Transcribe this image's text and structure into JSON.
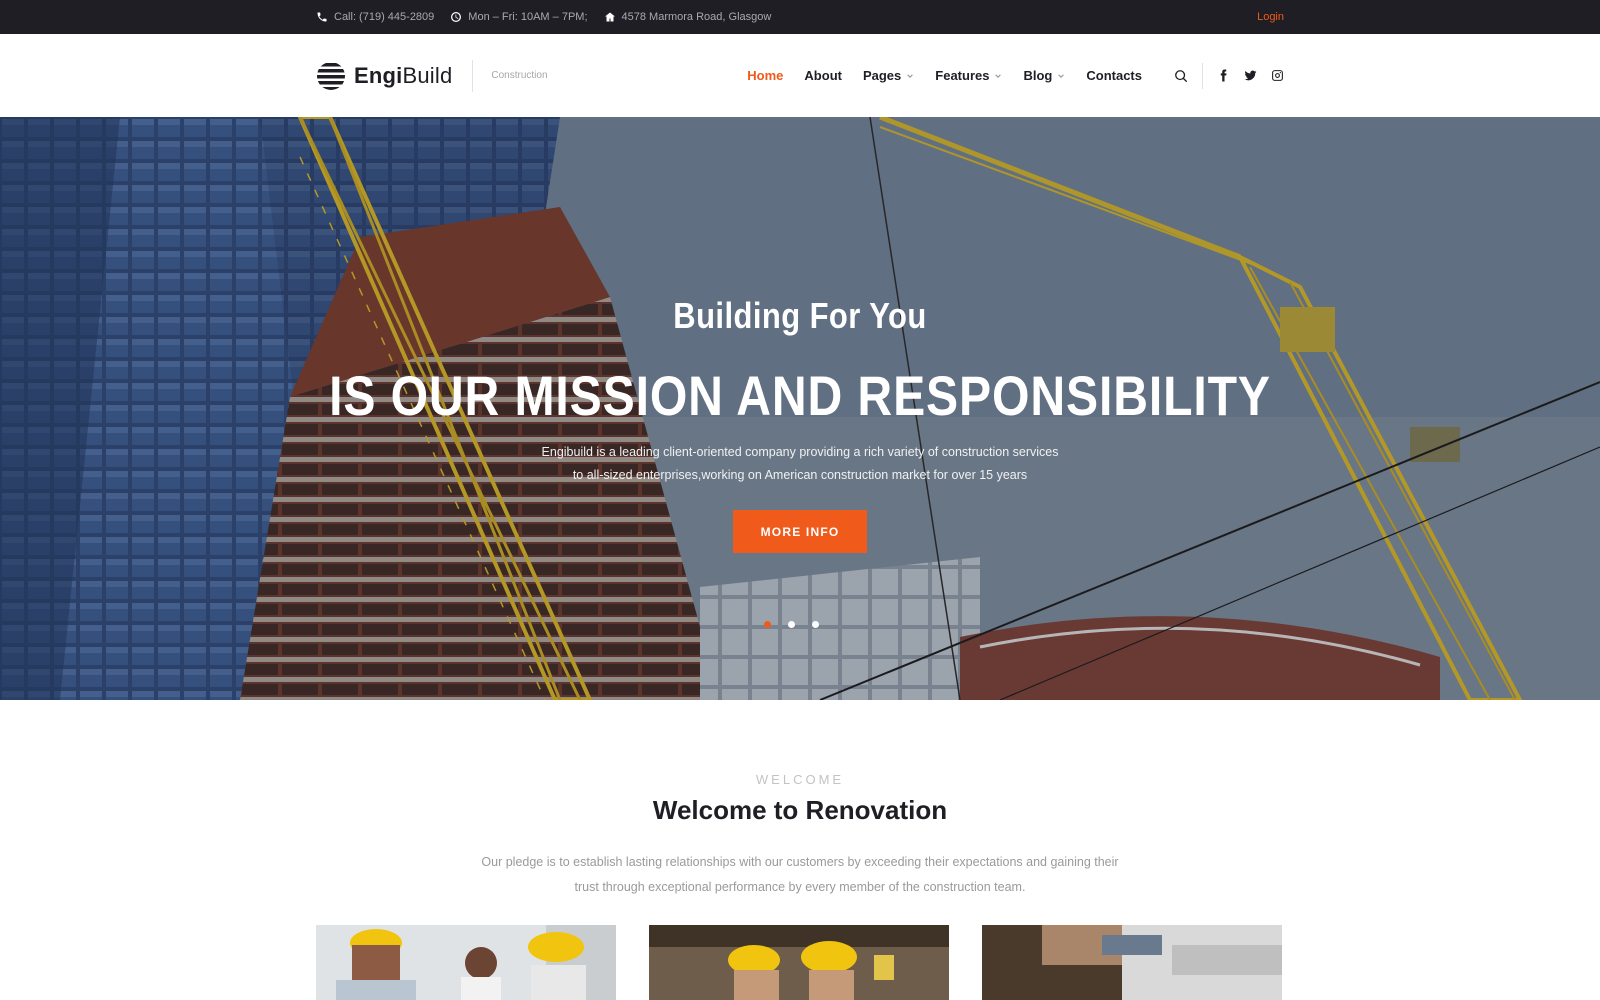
{
  "topbar": {
    "phone": "Call: (719) 445-2809",
    "hours": "Mon – Fri: 10AM – 7PM;",
    "address": "4578 Marmora Road, Glasgow",
    "login": "Login"
  },
  "header": {
    "logo_bold": "Engi",
    "logo_light": "Build",
    "tagline": "Construction",
    "nav": [
      {
        "label": "Home",
        "active": true
      },
      {
        "label": "About"
      },
      {
        "label": "Pages",
        "dropdown": true
      },
      {
        "label": "Features",
        "dropdown": true
      },
      {
        "label": "Blog",
        "dropdown": true
      },
      {
        "label": "Contacts"
      }
    ],
    "icons": [
      "search-icon",
      "facebook-icon",
      "twitter-icon",
      "instagram-icon"
    ]
  },
  "hero": {
    "subtitle": "Building For You",
    "title": "IS OUR MISSION AND RESPONSIBILITY",
    "desc_line1": "Engibuild is a leading client-oriented company providing a rich variety of construction services",
    "desc_line2": "to all-sized enterprises,working on American construction market for over 15 years",
    "button": "MORE INFO",
    "slides_total": 3,
    "active_slide": 1
  },
  "welcome": {
    "kicker": "WELCOME",
    "title": "Welcome to Renovation",
    "text_line1": "Our pledge is to establish lasting relationships with our customers by exceeding their expectations and gaining their",
    "text_line2": "trust through exceptional performance by every member of the construction team."
  },
  "colors": {
    "accent": "#f05a1a",
    "topbar_bg": "#1e1e24",
    "heading": "#1e1e24"
  }
}
